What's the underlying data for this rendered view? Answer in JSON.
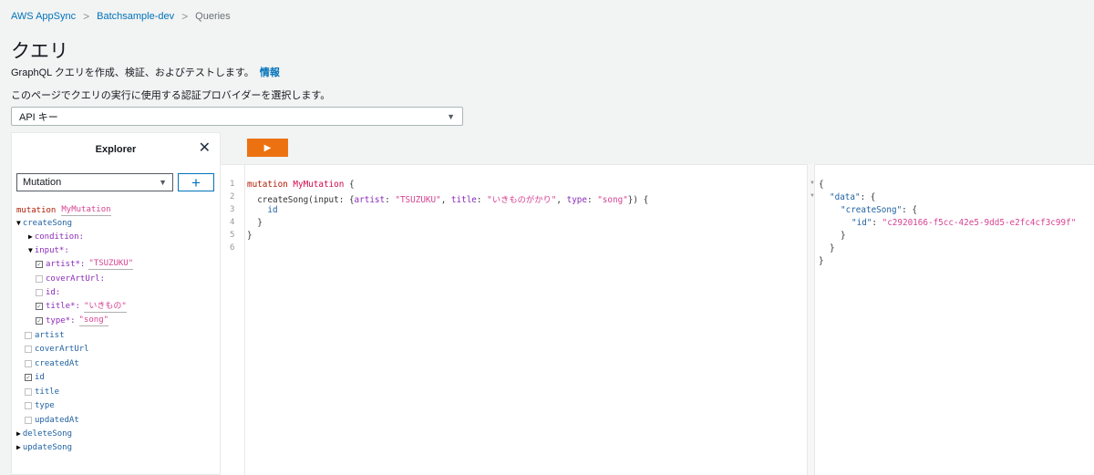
{
  "breadcrumb": {
    "items": [
      "AWS AppSync",
      "Batchsample-dev",
      "Queries"
    ],
    "separator": ">"
  },
  "page": {
    "title": "クエリ",
    "subtitle": "GraphQL クエリを作成、検証、およびテストします。",
    "info_link": "情報",
    "auth_description": "このページでクエリの実行に使用する認証プロバイダーを選択します。",
    "auth_selected": "API キー"
  },
  "explorer": {
    "title": "Explorer",
    "close": "✕",
    "operation_selected": "Mutation",
    "add": "+",
    "op_keyword": "mutation",
    "op_name": "MyMutation",
    "tree": {
      "createSong": "createSong",
      "condition": "condition:",
      "input": "input*:",
      "artist_arg": "artist*:",
      "artist_value": "\"TSUZUKU\"",
      "coverArtUrl_arg": "coverArtUrl:",
      "id_arg": "id:",
      "title_arg": "title*:",
      "title_value": "\"いきもの\"",
      "type_arg": "type*:",
      "type_value": "\"song\"",
      "f_artist": "artist",
      "f_coverArtUrl": "coverArtUrl",
      "f_createdAt": "createdAt",
      "f_id": "id",
      "f_title": "title",
      "f_type": "type",
      "f_updatedAt": "updatedAt",
      "deleteSong": "deleteSong",
      "updateSong": "updateSong"
    }
  },
  "run_button": "▶",
  "editor": {
    "line_numbers": [
      "1",
      "2",
      "3",
      "4",
      "5",
      "6"
    ],
    "l1_kw": "mutation",
    "l1_name": "MyMutation",
    "l1_rest": " {",
    "l2_field": "  createSong",
    "l2_a": "(input: {",
    "l2_artist": "artist",
    "l2_b": ": ",
    "l2_artist_val": "\"TSUZUKU\"",
    "l2_c": ", ",
    "l2_title": "title",
    "l2_d": ": ",
    "l2_title_val": "\"いきものがかり\"",
    "l2_e": ", ",
    "l2_type": "type",
    "l2_f": ": ",
    "l2_type_val": "\"song\"",
    "l2_g": "}) {",
    "l3": "    id",
    "l4": "  }",
    "l5": "}"
  },
  "result": {
    "l1": "{",
    "l2_key": "\"data\"",
    "l2_rest": ": {",
    "l3_key": "\"createSong\"",
    "l3_rest": ": {",
    "l4_key": "\"id\"",
    "l4_sep": ": ",
    "l4_val": "\"c2920166-f5cc-42e5-9dd5-e2fc4cf3c99f\"",
    "l5": "}",
    "l6": "}",
    "l7": "}"
  },
  "colors": {
    "accent": "#ec7211",
    "link": "#0073bb",
    "keyword": "#b11a04",
    "string": "#d64292"
  }
}
